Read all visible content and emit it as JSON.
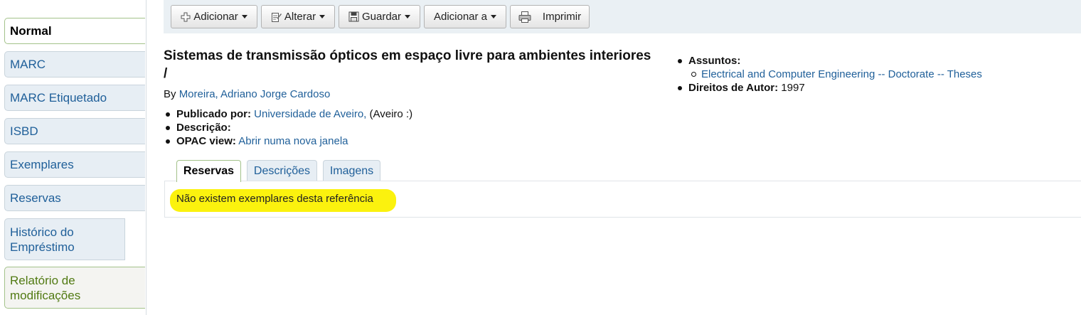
{
  "sidebar": {
    "tabs": [
      {
        "label": "Normal"
      },
      {
        "label": "MARC"
      },
      {
        "label": "MARC Etiquetado"
      },
      {
        "label": "ISBD"
      },
      {
        "label": "Exemplares"
      },
      {
        "label": "Reservas"
      },
      {
        "label": "Histórico do Empréstimo"
      },
      {
        "label": "Relatório de modificações"
      }
    ]
  },
  "toolbar": {
    "add_label": "Adicionar",
    "edit_label": "Alterar",
    "save_label": "Guardar",
    "add_to_label": "Adicionar a",
    "print_label": "Imprimir"
  },
  "record": {
    "title": "Sistemas de transmissão ópticos em espaço livre para ambientes interiores /",
    "by_prefix": "By",
    "author": "Moreira, Adriano Jorge Cardoso",
    "published_label": "Publicado por:",
    "publisher": "Universidade de Aveiro,",
    "place": "(Aveiro :)",
    "description_label": "Descrição:",
    "opac_label": "OPAC view:",
    "opac_link": "Abrir numa nova janela",
    "subjects_label": "Assuntos:",
    "subject_link": "Electrical and Computer Engineering -- Doctorate -- Theses",
    "copyright_label": "Direitos de Autor:",
    "copyright_value": "1997"
  },
  "tabs": [
    {
      "label": "Reservas"
    },
    {
      "label": "Descrições"
    },
    {
      "label": "Imagens"
    }
  ],
  "panel": {
    "message": "Não existem exemplares desta referência"
  },
  "colors": {
    "link": "#1f5f99",
    "highlight": "#fbf20e",
    "active_border": "#a3c28a",
    "toolbar_bg": "#eaf0f4"
  }
}
